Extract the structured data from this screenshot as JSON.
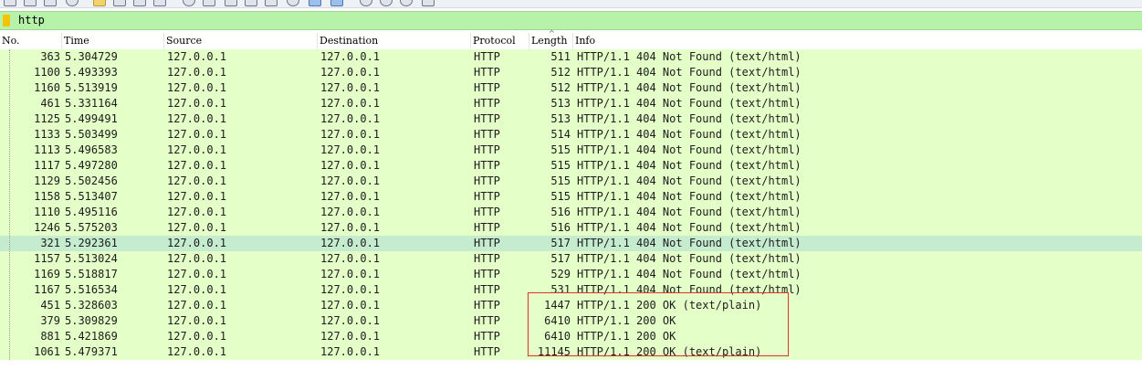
{
  "filter": {
    "value": "http"
  },
  "columns": [
    "No.",
    "Time",
    "Source",
    "Destination",
    "Protocol",
    "Length",
    "Info"
  ],
  "packets": [
    {
      "no": "363",
      "time": "5.304729",
      "source": "127.0.0.1",
      "destination": "127.0.0.1",
      "protocol": "HTTP",
      "length": "511",
      "info": "HTTP/1.1 404 Not Found  (text/html)"
    },
    {
      "no": "1100",
      "time": "5.493393",
      "source": "127.0.0.1",
      "destination": "127.0.0.1",
      "protocol": "HTTP",
      "length": "512",
      "info": "HTTP/1.1 404 Not Found  (text/html)"
    },
    {
      "no": "1160",
      "time": "5.513919",
      "source": "127.0.0.1",
      "destination": "127.0.0.1",
      "protocol": "HTTP",
      "length": "512",
      "info": "HTTP/1.1 404 Not Found  (text/html)"
    },
    {
      "no": "461",
      "time": "5.331164",
      "source": "127.0.0.1",
      "destination": "127.0.0.1",
      "protocol": "HTTP",
      "length": "513",
      "info": "HTTP/1.1 404 Not Found  (text/html)"
    },
    {
      "no": "1125",
      "time": "5.499491",
      "source": "127.0.0.1",
      "destination": "127.0.0.1",
      "protocol": "HTTP",
      "length": "513",
      "info": "HTTP/1.1 404 Not Found  (text/html)"
    },
    {
      "no": "1133",
      "time": "5.503499",
      "source": "127.0.0.1",
      "destination": "127.0.0.1",
      "protocol": "HTTP",
      "length": "514",
      "info": "HTTP/1.1 404 Not Found  (text/html)"
    },
    {
      "no": "1113",
      "time": "5.496583",
      "source": "127.0.0.1",
      "destination": "127.0.0.1",
      "protocol": "HTTP",
      "length": "515",
      "info": "HTTP/1.1 404 Not Found  (text/html)"
    },
    {
      "no": "1117",
      "time": "5.497280",
      "source": "127.0.0.1",
      "destination": "127.0.0.1",
      "protocol": "HTTP",
      "length": "515",
      "info": "HTTP/1.1 404 Not Found  (text/html)"
    },
    {
      "no": "1129",
      "time": "5.502456",
      "source": "127.0.0.1",
      "destination": "127.0.0.1",
      "protocol": "HTTP",
      "length": "515",
      "info": "HTTP/1.1 404 Not Found  (text/html)"
    },
    {
      "no": "1158",
      "time": "5.513407",
      "source": "127.0.0.1",
      "destination": "127.0.0.1",
      "protocol": "HTTP",
      "length": "515",
      "info": "HTTP/1.1 404 Not Found  (text/html)"
    },
    {
      "no": "1110",
      "time": "5.495116",
      "source": "127.0.0.1",
      "destination": "127.0.0.1",
      "protocol": "HTTP",
      "length": "516",
      "info": "HTTP/1.1 404 Not Found  (text/html)"
    },
    {
      "no": "1246",
      "time": "5.575203",
      "source": "127.0.0.1",
      "destination": "127.0.0.1",
      "protocol": "HTTP",
      "length": "516",
      "info": "HTTP/1.1 404 Not Found  (text/html)"
    },
    {
      "no": "321",
      "time": "5.292361",
      "source": "127.0.0.1",
      "destination": "127.0.0.1",
      "protocol": "HTTP",
      "length": "517",
      "info": "HTTP/1.1 404 Not Found  (text/html)",
      "selected": true
    },
    {
      "no": "1157",
      "time": "5.513024",
      "source": "127.0.0.1",
      "destination": "127.0.0.1",
      "protocol": "HTTP",
      "length": "517",
      "info": "HTTP/1.1 404 Not Found  (text/html)"
    },
    {
      "no": "1169",
      "time": "5.518817",
      "source": "127.0.0.1",
      "destination": "127.0.0.1",
      "protocol": "HTTP",
      "length": "529",
      "info": "HTTP/1.1 404 Not Found  (text/html)"
    },
    {
      "no": "1167",
      "time": "5.516534",
      "source": "127.0.0.1",
      "destination": "127.0.0.1",
      "protocol": "HTTP",
      "length": "531",
      "info": "HTTP/1.1 404 Not Found  (text/html)"
    },
    {
      "no": "451",
      "time": "5.328603",
      "source": "127.0.0.1",
      "destination": "127.0.0.1",
      "protocol": "HTTP",
      "length": "1447",
      "info": "HTTP/1.1 200 OK  (text/plain)"
    },
    {
      "no": "379",
      "time": "5.309829",
      "source": "127.0.0.1",
      "destination": "127.0.0.1",
      "protocol": "HTTP",
      "length": "6410",
      "info": "HTTP/1.1 200 OK"
    },
    {
      "no": "881",
      "time": "5.421869",
      "source": "127.0.0.1",
      "destination": "127.0.0.1",
      "protocol": "HTTP",
      "length": "6410",
      "info": "HTTP/1.1 200 OK"
    },
    {
      "no": "1061",
      "time": "5.479371",
      "source": "127.0.0.1",
      "destination": "127.0.0.1",
      "protocol": "HTTP",
      "length": "11145",
      "info": "HTTP/1.1 200 OK  (text/plain)"
    }
  ],
  "colors": {
    "row_background": "#e4ffc7",
    "selected_row": "#c6ecd0",
    "filter_background": "#b6f2a8",
    "annotation_box": "#e0342b"
  },
  "icons": {
    "bookmark": "filter-bookmark-icon",
    "sort": "sort-ascending-icon"
  }
}
